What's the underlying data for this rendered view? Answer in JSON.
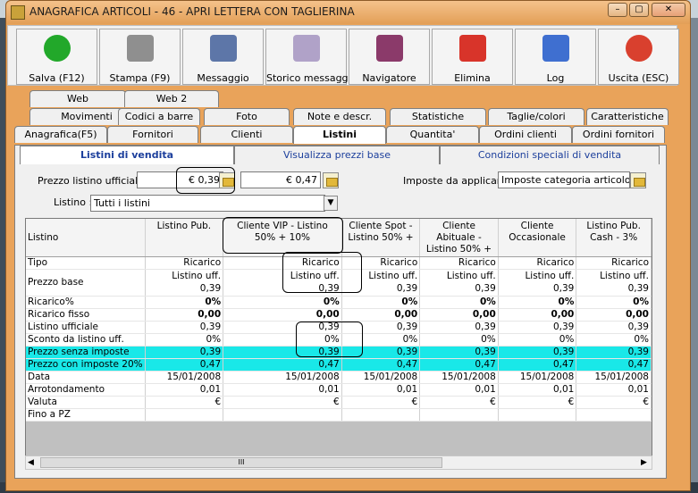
{
  "window": {
    "title": "ANAGRAFICA ARTICOLI - 46 - APRI LETTERA CON TAGLIERINA"
  },
  "toolbar": [
    {
      "label": "Salva (F12)",
      "icon": "check-icon",
      "color": "#22a82a"
    },
    {
      "label": "Stampa (F9)",
      "icon": "printer-icon",
      "color": "#8f8f8f"
    },
    {
      "label": "Messaggio",
      "icon": "envelope-pen-icon",
      "color": "#5d76a8"
    },
    {
      "label": "Storico messaggi",
      "icon": "envelope-search-icon",
      "color": "#b0a2c8"
    },
    {
      "label": "Navigatore",
      "icon": "compass-icon",
      "color": "#8b3a6a"
    },
    {
      "label": "Elimina",
      "icon": "delete-x-icon",
      "color": "#d8342a"
    },
    {
      "label": "Log",
      "icon": "log-search-icon",
      "color": "#3f6fd0"
    },
    {
      "label": "Uscita (ESC)",
      "icon": "power-icon",
      "color": "#d9402e"
    }
  ],
  "tabs_row1": [
    "Web",
    "Web 2"
  ],
  "tabs_row2": [
    "Movimenti",
    "Codici a barre",
    "Foto",
    "Note e descr.",
    "Statistiche",
    "Taglie/colori",
    "Caratteristiche"
  ],
  "tabs_row3": [
    "Anagrafica(F5)",
    "Fornitori",
    "Clienti",
    "Listini",
    "Quantita'",
    "Ordini clienti",
    "Ordini fornitori"
  ],
  "subtabs": [
    "Listini di vendita",
    "Visualizza prezzi base",
    "Condizioni speciali di vendita"
  ],
  "form": {
    "prezzo_label": "Prezzo listino ufficiale :",
    "prezzo_value": "€ 0,39",
    "prezzo_value2": "€ 0,47",
    "imposte_label": "Imposte da applicare :",
    "imposte_value": "Imposte categoria articolo",
    "listino_label": "Listino :",
    "listino_value": "Tutti i listini"
  },
  "grid": {
    "columns": [
      "Listino",
      "Listino Pub.",
      "Cliente VIP - Listino 50% + 10%",
      "Cliente Spot - Listino 50% +",
      "Cliente Abituale - Listino 50% +",
      "Cliente Occasionale",
      "Listino Pub. Cash - 3%"
    ],
    "rows": [
      {
        "label": "Tipo",
        "values": [
          "Ricarico",
          "Ricarico",
          "Ricarico",
          "Ricarico",
          "Ricarico",
          "Ricarico"
        ]
      },
      {
        "label": "Prezzo base",
        "values": [
          "Listino uff.\n0,39",
          "Listino uff.\n0,39",
          "Listino uff.\n0,39",
          "Listino uff.\n0,39",
          "Listino uff.\n0,39",
          "Listino uff.\n0,39"
        ],
        "tall": true
      },
      {
        "label": "Ricarico%",
        "values": [
          "0%",
          "0%",
          "0%",
          "0%",
          "0%",
          "0%"
        ],
        "bold": true
      },
      {
        "label": "Ricarico fisso",
        "values": [
          "0,00",
          "0,00",
          "0,00",
          "0,00",
          "0,00",
          "0,00"
        ],
        "bold": true
      },
      {
        "label": "Listino ufficiale",
        "values": [
          "0,39",
          "0,39",
          "0,39",
          "0,39",
          "0,39",
          "0,39"
        ]
      },
      {
        "label": "Sconto da listino uff.",
        "values": [
          "0%",
          "0%",
          "0%",
          "0%",
          "0%",
          "0%"
        ]
      },
      {
        "label": "Prezzo senza imposte",
        "values": [
          "0,39",
          "0,39",
          "0,39",
          "0,39",
          "0,39",
          "0,39"
        ],
        "cyan": true
      },
      {
        "label": "Prezzo con imposte 20%",
        "values": [
          "0,47",
          "0,47",
          "0,47",
          "0,47",
          "0,47",
          "0,47"
        ],
        "cyan": true
      },
      {
        "label": "Data",
        "values": [
          "15/01/2008",
          "15/01/2008",
          "15/01/2008",
          "15/01/2008",
          "15/01/2008",
          "15/01/2008"
        ]
      },
      {
        "label": "Arrotondamento",
        "values": [
          "0,01",
          "0,01",
          "0,01",
          "0,01",
          "0,01",
          "0,01"
        ]
      },
      {
        "label": "Valuta",
        "values": [
          "€",
          "€",
          "€",
          "€",
          "€",
          "€"
        ]
      },
      {
        "label": "Fino a PZ",
        "values": [
          "",
          "",
          "",
          "",
          "",
          ""
        ]
      }
    ]
  },
  "colors": {
    "window_frame": "#e9a35a",
    "highlight_rows": "#19e8e8"
  }
}
